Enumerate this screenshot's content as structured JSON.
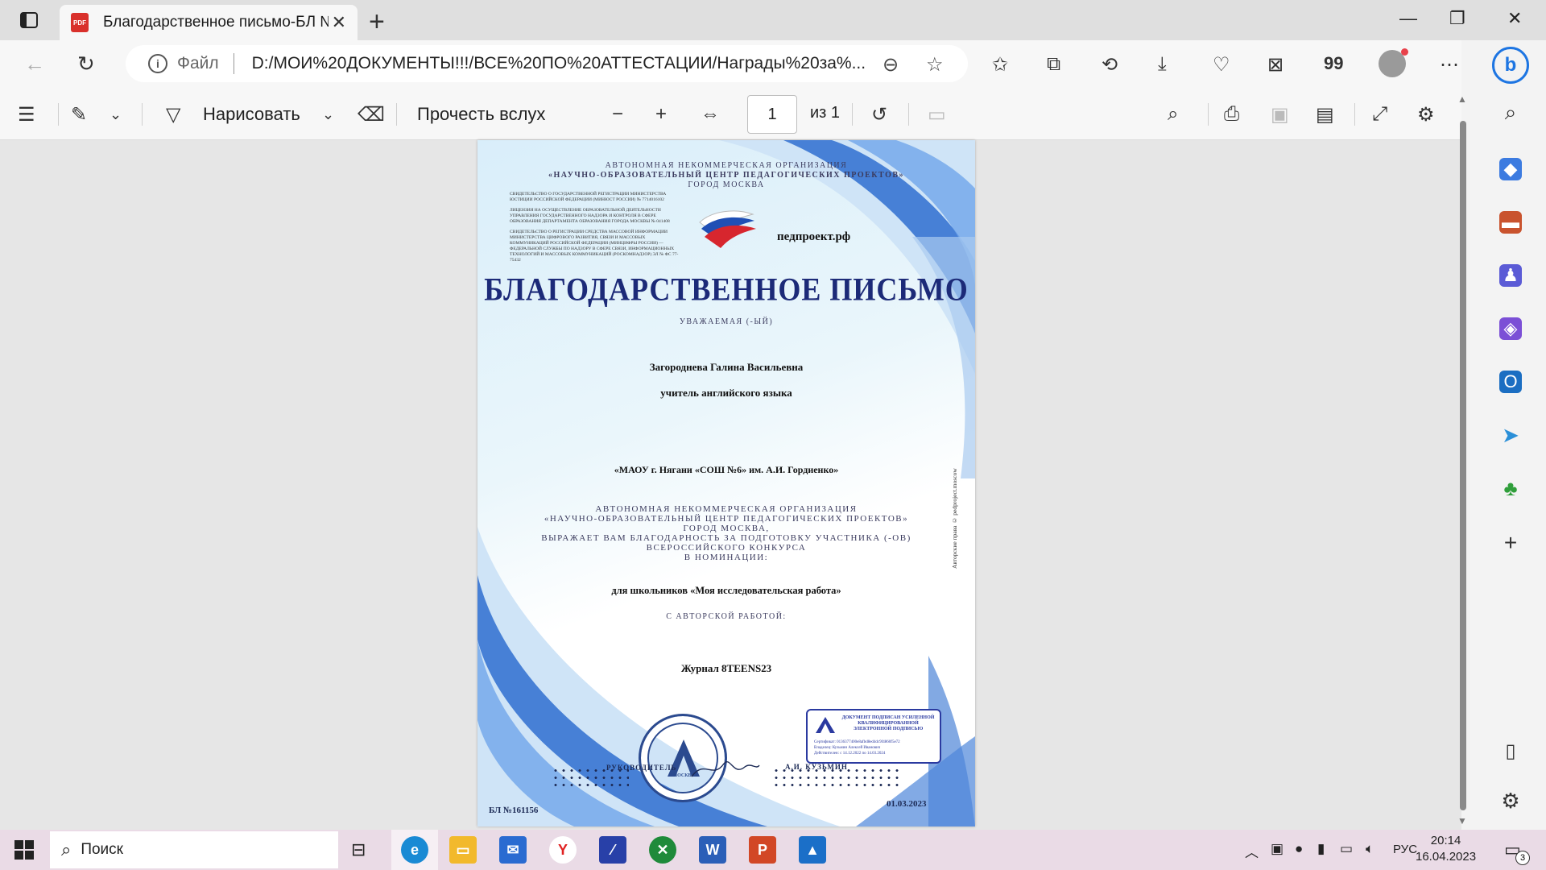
{
  "tab": {
    "badge": "PDF",
    "title": "Благодарственное письмо-БЛ №161156"
  },
  "address": {
    "scheme": "Файл",
    "url": "D:/МОИ%20ДОКУМЕНТЫ!!!/ВСЕ%20ПО%20АТТЕСТАЦИИ/Награды%20за%..."
  },
  "browser_toolbar": {
    "badge_count": "99",
    "bing_label": "b"
  },
  "pdf_toolbar": {
    "draw_label": "Нарисовать",
    "read_aloud_label": "Прочесть вслух",
    "page_current": "1",
    "page_total": "из 1"
  },
  "document": {
    "org_line1": "АВТОНОМНАЯ НЕКОММЕРЧЕСКАЯ ОРГАНИЗАЦИЯ",
    "org_line2": "«НАУЧНО-ОБРАЗОВАТЕЛЬНЫЙ ЦЕНТР ПЕДАГОГИЧЕСКИХ ПРОЕКТОВ»",
    "org_line3": "ГОРОД МОСКВА",
    "reg1": "СВИДЕТЕЛЬСТВО О ГОСУДАРСТВЕННОЙ РЕГИСТРАЦИИ МИНИСТЕРСТВА ЮСТИЦИИ РОССИЙСКОЙ ФЕДЕРАЦИИ (МИНЮСТ РОССИИ) № 7714016102",
    "reg2": "ЛИЦЕНЗИЯ НА ОСУЩЕСТВЛЕНИЕ ОБРАЗОВАТЕЛЬНОЙ ДЕЯТЕЛЬНОСТИ УПРАВЛЕНИЯ ГОСУДАРСТВЕННОГО НАДЗОРА И КОНТРОЛЯ В СФЕРЕ ОБРАЗОВАНИЯ ДЕПАРТАМЕНТА ОБРАЗОВАНИЯ ГОРОДА МОСКВЫ № 041408",
    "reg3": "СВИДЕТЕЛЬСТВО О РЕГИСТРАЦИИ СРЕДСТВА МАССОВОЙ ИНФОРМАЦИИ МИНИСТЕРСТВА ЦИФРОВОГО РАЗВИТИЯ, СВЯЗИ И МАССОВЫХ КОММУНИКАЦИЙ РОССИЙСКОЙ ФЕДЕРАЦИИ (МИНЦИФРЫ РОССИИ) — ФЕДЕРАЛЬНОЙ СЛУЖБЫ ПО НАДЗОРУ В СФЕРЕ СВЯЗИ, ИНФОРМАЦИОННЫХ ТЕХНОЛОГИЙ И МАССОВЫХ КОММУНИКАЦИЙ (РОСКОМНАДЗОР) ЭЛ № ФС 77-75432",
    "site": "педпроект.рф",
    "title": "БЛАГОДАРСТВЕННОЕ ПИСЬМО",
    "salutation": "УВАЖАЕМАЯ (-ЫЙ)",
    "recipient_name": "Загороднева Галина Васильевна",
    "recipient_role": "учитель английского языка",
    "school": "«МАОУ г. Нягани «СОШ №6» им. А.И. Гордиенко»",
    "body1": "АВТОНОМНАЯ НЕКОММЕРЧЕСКАЯ ОРГАНИЗАЦИЯ",
    "body2": "«НАУЧНО-ОБРАЗОВАТЕЛЬНЫЙ ЦЕНТР ПЕДАГОГИЧЕСКИХ ПРОЕКТОВ»",
    "body3": "ГОРОД МОСКВА,",
    "body4": "ВЫРАЖАЕТ ВАМ БЛАГОДАРНОСТЬ ЗА ПОДГОТОВКУ УЧАСТНИКА (-ОВ)",
    "body5": "ВСЕРОССИЙСКОГО КОНКУРСА",
    "body6": "В НОМИНАЦИИ:",
    "nomination": "для школьников «Моя исследовательская работа»",
    "work_label": "С АВТОРСКОЙ РАБОТОЙ:",
    "work_title": "Журнал 8TEENS23",
    "copyright_vertical": "Авторские права © pedproject.moscow",
    "ep_header": "ДОКУМЕНТ ПОДПИСАН УСИЛЕННОЙ КВАЛИФИЦИРОВАННОЙ ЭЛЕКТРОННОЙ ПОДПИСЬЮ",
    "ep_cert": "Сертификат: 0136377400e8afbd8ed4dc9f4860f5e72",
    "ep_owner": "Владелец: Кузьмин Алексей Иванович",
    "ep_valid": "Действителен: с 14.12.2022 по 14.03.2024",
    "head_label": "РУКОВОДИТЕЛЬ",
    "head_name": "А.И. КУЗЬМИН",
    "doc_number": "БЛ №161156",
    "doc_date": "01.03.2023",
    "stamp_city": "МОСКВА"
  },
  "taskbar": {
    "search_placeholder": "Поиск",
    "lang": "РУС",
    "time": "20:14",
    "date": "16.04.2023",
    "notifications": "3"
  },
  "colors": {
    "accent": "#1d75e2",
    "title_blue": "#1c2a78",
    "wave_blue": "#2f6fd0"
  }
}
